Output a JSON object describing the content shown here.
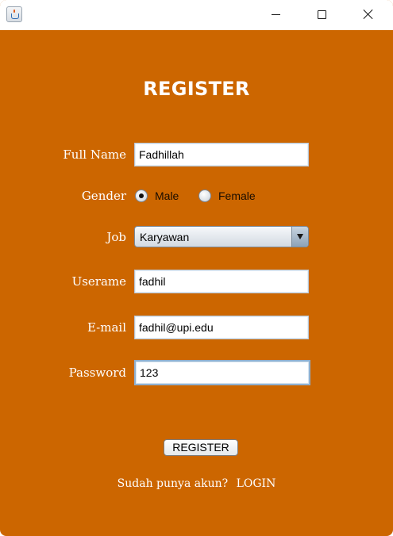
{
  "window": {
    "controls": {
      "minimize": "minimize-icon",
      "maximize": "maximize-icon",
      "close": "close-icon"
    },
    "background_color": "#cc6600"
  },
  "form": {
    "title": "REGISTER",
    "full_name": {
      "label": "Full Name",
      "value": "Fadhillah"
    },
    "gender": {
      "label": "Gender",
      "options": [
        {
          "label": "Male",
          "selected": true
        },
        {
          "label": "Female",
          "selected": false
        }
      ]
    },
    "job": {
      "label": "Job",
      "selected": "Karyawan"
    },
    "username": {
      "label": "Userame",
      "value": "fadhil"
    },
    "email": {
      "label": "E-mail",
      "value": "fadhil@upi.edu"
    },
    "password": {
      "label": "Password",
      "value": "123"
    },
    "submit_label": "REGISTER"
  },
  "footer": {
    "prompt": "Sudah punya akun?",
    "login_link": "LOGIN"
  }
}
